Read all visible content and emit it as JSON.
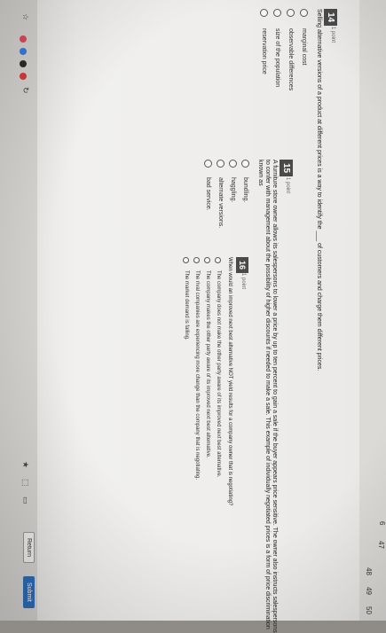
{
  "gutter_numbers": [
    "48",
    "49",
    "50",
    "6",
    "47"
  ],
  "q14": {
    "number": "14",
    "points": "1 point",
    "text": "Selling alternative versions of a product at different prices is a way to identify the ___ of customers and charge them different prices.",
    "options": [
      "marginal cost",
      "observable differences",
      "size of the population",
      "reservation price"
    ]
  },
  "q15": {
    "number": "15",
    "points": "1 point",
    "text_lines": [
      "A furniture store owner allows its salespersons to lower a price by up to ten percent to gain a sale if the buyer appears price sensitive. The owner also instructs salespersons",
      "to confer with management about the possibility of higher discounts if needed to make a sale. This example of individually negotiated prices is a form of price discrimination",
      "known as"
    ],
    "options": [
      "bundling.",
      "haggling.",
      "alternate versions.",
      "bad service."
    ]
  },
  "q16": {
    "number": "16",
    "points": "1 point",
    "text": "When would an improved next best alternative NOT yield results for a company owner that is negotiating?",
    "options": [
      "The company does not make the other party aware of its improved next best alternative.",
      "The company makes the other party aware of its improved next best alternative.",
      "The rival companies are experiencing more change than the company that is negotiating.",
      "The market demand is falling."
    ]
  },
  "toolbar": {
    "return_label": "Return",
    "submit_label": "Submit"
  },
  "colors": {
    "submit": "#2f6db8",
    "question_badge": "#4a4a4a"
  },
  "icons": [
    "star-icon",
    "extension-icon",
    "chrome-extension-icons",
    "arrow-icon"
  ]
}
